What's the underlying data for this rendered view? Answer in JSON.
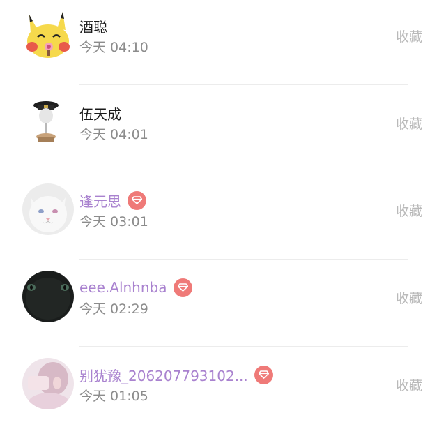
{
  "rows": [
    {
      "name": "酒聪",
      "time": "今天 04:10",
      "action": "收藏",
      "vip": false,
      "avatar": "pikachu-avatar"
    },
    {
      "name": "伍天成",
      "time": "今天 04:01",
      "action": "收藏",
      "vip": false,
      "avatar": "officer-figure-avatar"
    },
    {
      "name": "逢元思",
      "time": "今天 03:01",
      "action": "收藏",
      "vip": true,
      "avatar": "white-cat-avatar"
    },
    {
      "name": "eee.Alnhnba",
      "time": "今天 02:29",
      "action": "收藏",
      "vip": true,
      "avatar": "black-cat-avatar"
    },
    {
      "name": "别犹豫_206207793102...",
      "time": "今天 01:05",
      "action": "收藏",
      "vip": true,
      "avatar": "girl-photo-avatar"
    }
  ],
  "colors": {
    "vip_name": "#a982cf",
    "vip_badge": "#ef7a78",
    "action": "#b9b9b9",
    "time": "#8c8c8c"
  },
  "icons": {
    "vip_badge": "diamond-icon"
  }
}
